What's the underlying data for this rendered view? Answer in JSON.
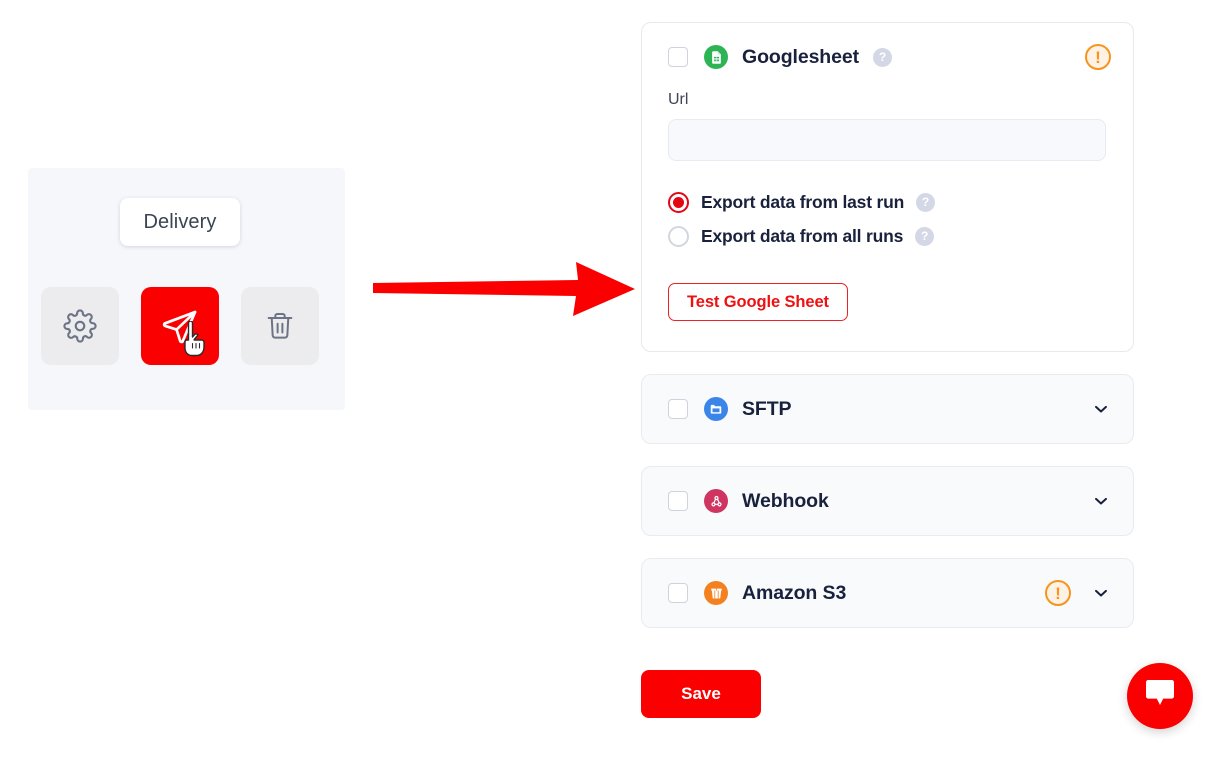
{
  "delivery_widget": {
    "tooltip_label": "Delivery",
    "buttons": [
      {
        "name": "settings",
        "icon": "gear-icon",
        "active": false
      },
      {
        "name": "delivery",
        "icon": "paper-plane-icon",
        "active": true
      },
      {
        "name": "delete",
        "icon": "trash-icon",
        "active": false
      }
    ],
    "active_color": "#fa0000",
    "panel_bg": "#f6f7fb"
  },
  "annotation": {
    "type": "arrow",
    "color": "#fa0000",
    "direction": "right"
  },
  "targets": {
    "googlesheet": {
      "name": "Googlesheet",
      "icon": "google-sheet-icon",
      "icon_color": "#2eb455",
      "checked": false,
      "expanded": true,
      "status": "warning",
      "help": "?",
      "url_label": "Url",
      "url_value": "",
      "url_placeholder": "",
      "radios": [
        {
          "label": "Export data from last run",
          "selected": true,
          "help": "?"
        },
        {
          "label": "Export data from all runs",
          "selected": false,
          "help": "?"
        }
      ],
      "test_button": "Test Google Sheet"
    },
    "sftp": {
      "name": "SFTP",
      "icon": "sftp-folder-icon",
      "icon_color": "#3a86e8",
      "checked": false,
      "expanded": false,
      "status": "none",
      "chevron": "chevron-down-icon"
    },
    "webhook": {
      "name": "Webhook",
      "icon": "webhook-icon",
      "icon_color": "#ce3561",
      "checked": false,
      "expanded": false,
      "status": "none",
      "chevron": "chevron-down-icon"
    },
    "amazon_s3": {
      "name": "Amazon S3",
      "icon": "amazon-s3-bucket-icon",
      "icon_color": "#f48120",
      "checked": false,
      "expanded": false,
      "status": "warning",
      "chevron": "chevron-down-icon"
    }
  },
  "actions": {
    "save_label": "Save"
  },
  "chat": {
    "icon": "chat-bubble-icon",
    "color": "#fa0000"
  },
  "warning_symbol": "!",
  "colors": {
    "brand_red": "#fa0000",
    "warning_orange": "#f7941e",
    "text_dark": "#19213d"
  }
}
